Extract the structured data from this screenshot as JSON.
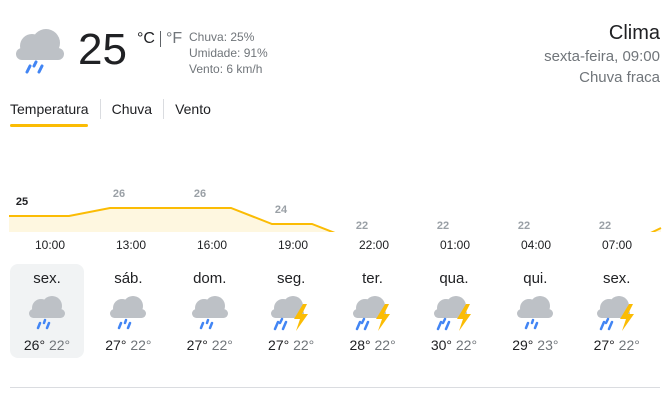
{
  "current": {
    "icon": "rain-cloud-icon",
    "temperature": "25",
    "unit_c": "°C",
    "unit_f": "°F",
    "chuva": "Chuva: 25%",
    "umidade": "Umidade: 91%",
    "vento": "Vento: 6 km/h"
  },
  "header": {
    "title": "Clima",
    "datetime": "sexta-feira, 09:00",
    "condition": "Chuva fraca"
  },
  "tabs": [
    {
      "label": "Temperatura"
    },
    {
      "label": "Chuva"
    },
    {
      "label": "Vento"
    }
  ],
  "chart_data": {
    "type": "area",
    "values": [
      25,
      26,
      26,
      24,
      22,
      22,
      22,
      22
    ],
    "value_labels": [
      "25",
      "26",
      "26",
      "24",
      "22",
      "22",
      "22",
      "22"
    ],
    "series_color": "#fbbc04",
    "fill_color": "#fef7e0"
  },
  "times": [
    "10:00",
    "13:00",
    "16:00",
    "19:00",
    "22:00",
    "01:00",
    "04:00",
    "07:00"
  ],
  "days": [
    {
      "name": "sex.",
      "icon": "rain-cloud-icon",
      "high": "26°",
      "low": "22°"
    },
    {
      "name": "sáb.",
      "icon": "rain-cloud-icon",
      "high": "27°",
      "low": "22°"
    },
    {
      "name": "dom.",
      "icon": "rain-cloud-icon",
      "high": "27°",
      "low": "22°"
    },
    {
      "name": "seg.",
      "icon": "thunderstorm-icon",
      "high": "27°",
      "low": "22°"
    },
    {
      "name": "ter.",
      "icon": "thunderstorm-icon",
      "high": "28°",
      "low": "22°"
    },
    {
      "name": "qua.",
      "icon": "thunderstorm-icon",
      "high": "30°",
      "low": "22°"
    },
    {
      "name": "qui.",
      "icon": "rain-cloud-icon",
      "high": "29°",
      "low": "23°"
    },
    {
      "name": "sex.",
      "icon": "thunderstorm-icon",
      "high": "27°",
      "low": "22°"
    }
  ],
  "colors": {
    "accent": "#fbbc04",
    "rain": "#4285f4",
    "bolt": "#fbbc04",
    "cloud": "#dadce0",
    "selected_bg": "#f1f3f4"
  }
}
